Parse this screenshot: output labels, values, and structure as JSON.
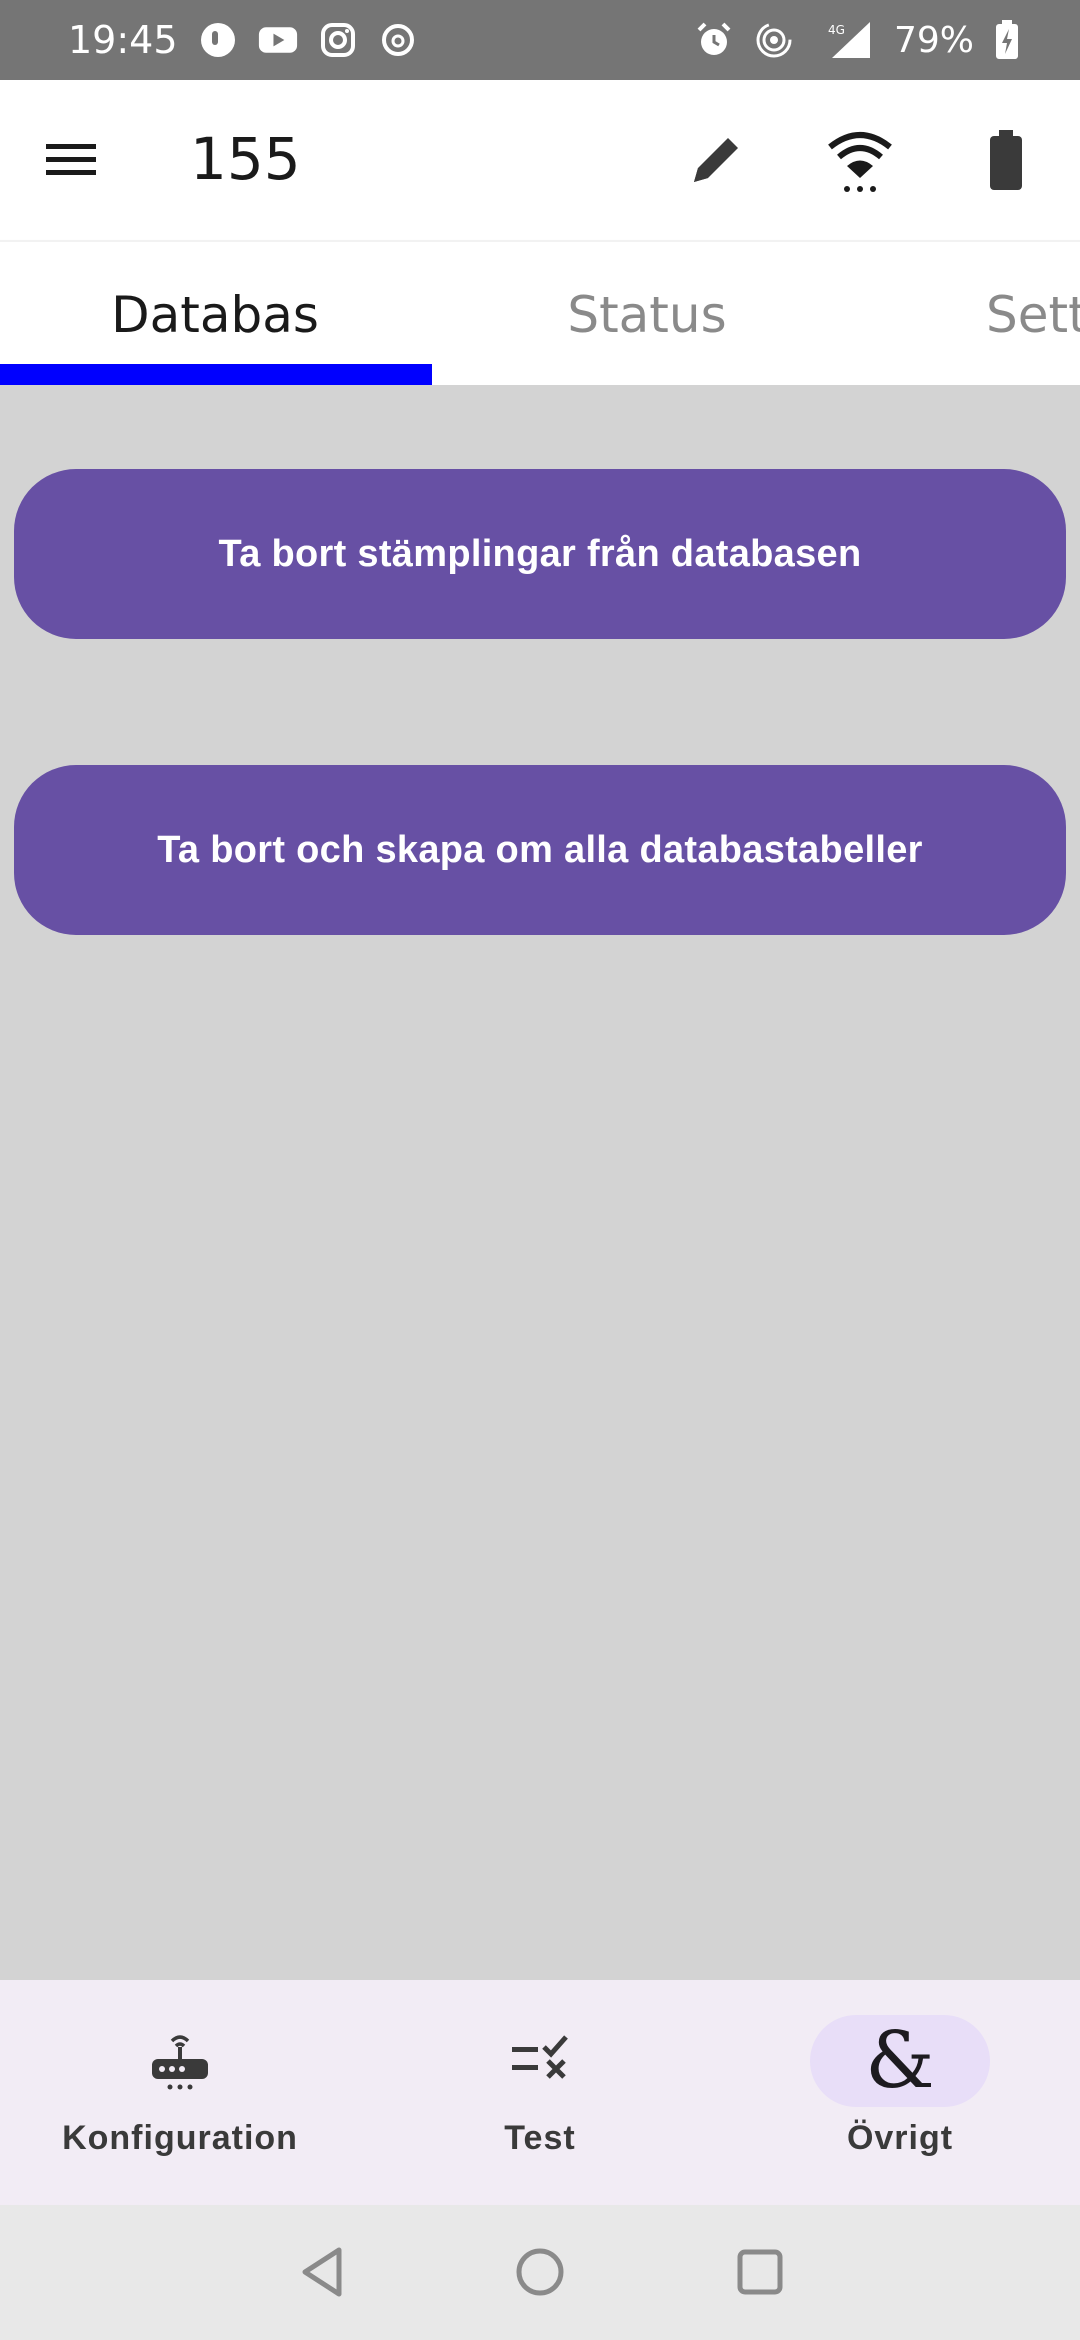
{
  "status_bar": {
    "time": "19:45",
    "battery_percent": "79%",
    "left_icons": [
      "tinder-icon",
      "youtube-icon",
      "instagram-icon",
      "threads-icon"
    ],
    "right_icons": [
      "alarm-icon",
      "hotspot-icon",
      "signal-4g-icon",
      "battery-charging-icon"
    ]
  },
  "app_bar": {
    "title": "155",
    "actions": [
      "pencil-icon",
      "wifi-icon",
      "battery-icon"
    ]
  },
  "tabs": {
    "items": [
      {
        "label": "Databas",
        "active": true
      },
      {
        "label": "Status",
        "active": false
      },
      {
        "label": "Sett",
        "active": false
      }
    ],
    "indicator_color": "#0000ff"
  },
  "main": {
    "buttons": [
      {
        "label": "Ta bort stämplingar från databasen"
      },
      {
        "label": "Ta bort och skapa om alla databastabeller"
      }
    ],
    "button_color": "#6750a4"
  },
  "bottom_nav": {
    "items": [
      {
        "label": "Konfiguration",
        "icon": "router-icon",
        "active": false
      },
      {
        "label": "Test",
        "icon": "rule-icon",
        "active": false
      },
      {
        "label": "Övrigt",
        "icon": "ampersand-icon",
        "icon_glyph": "&",
        "active": true
      }
    ]
  },
  "system_nav": [
    "back-icon",
    "home-icon",
    "recents-icon"
  ]
}
